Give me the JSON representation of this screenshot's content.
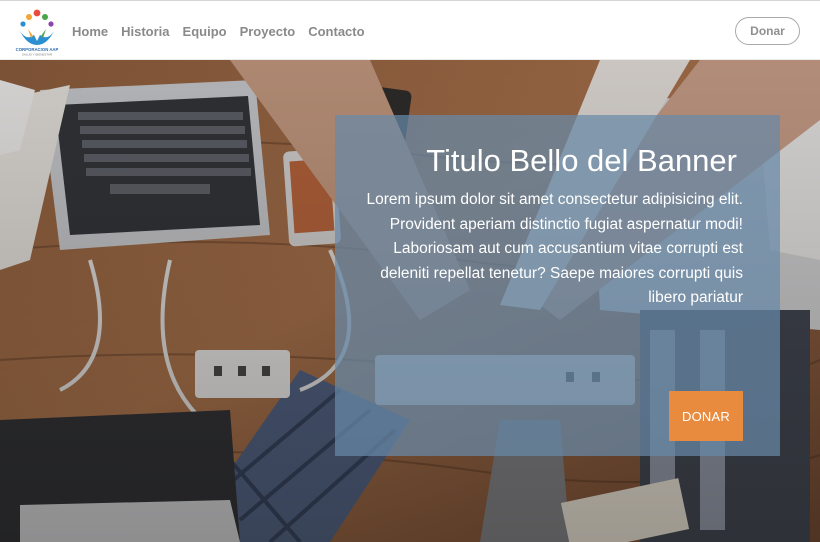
{
  "navbar": {
    "logo": {
      "name": "CORPORACION AAP",
      "tagline": "SALUD Y BIENESTAR"
    },
    "links": [
      "Home",
      "Historia",
      "Equipo",
      "Proyecto",
      "Contacto"
    ],
    "donate_label": "Donar"
  },
  "banner": {
    "title": "Titulo Bello del Banner",
    "text": "Lorem ipsum dolor sit amet consectetur adipisicing elit. Provident aperiam distinctio fugiat aspernatur modi! Laboriosam aut cum accusantium vitae corrupti est deleniti repellat tenetur? Saepe maiores corrupti quis libero pariatur",
    "button_label": "DONAR"
  },
  "colors": {
    "accent": "#e88b3f",
    "card_overlay": "#6889a8",
    "nav_text": "#8a8a8a"
  }
}
